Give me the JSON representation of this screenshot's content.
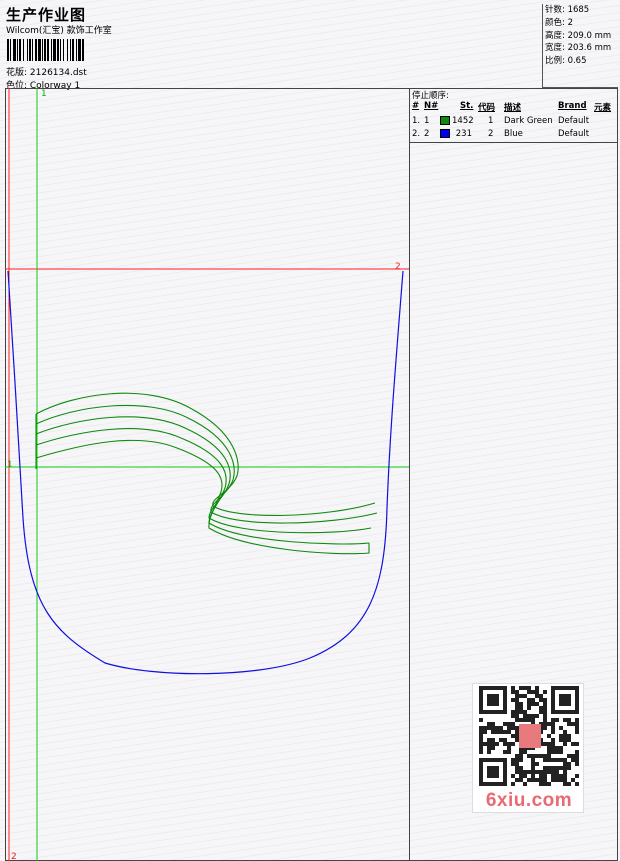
{
  "header": {
    "title": "生产作业图",
    "subtitle": "Wilcom(汇宝) 款饰工作室",
    "design_line": "花版: 2126134.dst",
    "colorway_line": "色位: Colorway 1"
  },
  "stats": [
    "针数: 1685",
    "颜色: 2",
    "高度: 209.0 mm",
    "宽度: 203.6 mm",
    "比例: 0.65"
  ],
  "stop_sequence": {
    "title": "停止顺序:",
    "headers": [
      "#",
      "N#",
      "St.",
      "代码",
      "描述",
      "Brand",
      "元素"
    ],
    "rows": [
      {
        "index": "1.",
        "needle": "1",
        "color": "#0e8a0e",
        "stitches": "1452",
        "code": "1",
        "description": "Dark Green",
        "brand": "Default"
      },
      {
        "index": "2.",
        "needle": "2",
        "color": "#0000ee",
        "stitches": "231",
        "code": "2",
        "description": "Blue",
        "brand": "Default"
      }
    ]
  },
  "canvas_marks": {
    "green_top": "1",
    "green_left": "1",
    "red_right": "2",
    "red_bottom": "2"
  },
  "colors": {
    "red_guide": "#ff2020",
    "green_guide": "#11cc11",
    "blue_stitch": "#1010dd",
    "green_stitch": "#0e8a0e"
  },
  "watermark": {
    "text": "6xiu.com"
  }
}
